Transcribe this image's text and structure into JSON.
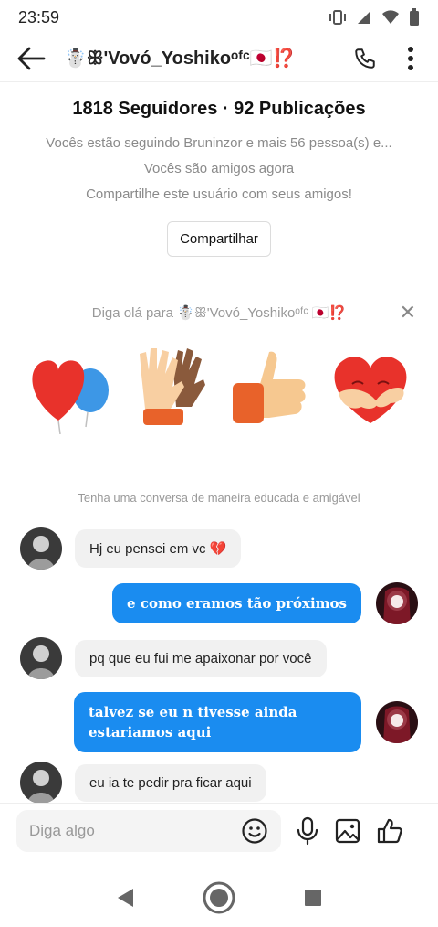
{
  "status": {
    "time": "23:59"
  },
  "header": {
    "title": "☃️ꕥ'Vovó_Yoshikoᵒᶠᶜ🇯🇵⁉️"
  },
  "profile": {
    "stats": "1818 Seguidores · 92 Publicações",
    "following_line": "Vocês estão seguindo Bruninzor e mais 56 pessoa(s) e...",
    "friends_line": "Vocês são amigos agora",
    "share_line": "Compartilhe este usuário com seus amigos!",
    "share_button": "Compartilhar"
  },
  "hello": {
    "text": "Diga olá para ☃️ꕥ'Vovó_Yoshikoᵒᶠᶜ 🇯🇵⁉️"
  },
  "conversation_hint": "Tenha uma conversa de maneira educada e amigável",
  "messages": [
    {
      "from": "them",
      "text": "Hj eu pensei em vc 💔"
    },
    {
      "from": "me",
      "text": "e como eramos tão próximos"
    },
    {
      "from": "them",
      "text": "pq que eu fui me apaixonar por você"
    },
    {
      "from": "me",
      "text": "talvez se eu n tivesse ainda estariamos aqui"
    },
    {
      "from": "them",
      "text": "eu ia te pedir pra ficar aqui"
    }
  ],
  "input": {
    "placeholder": "Diga algo"
  },
  "colors": {
    "accent": "#1a8cf0",
    "incoming_bubble": "#f1f1f1"
  },
  "icons": [
    "back-arrow-icon",
    "phone-icon",
    "more-vert-icon",
    "close-icon",
    "emoji-icon",
    "mic-icon",
    "image-icon",
    "thumbs-up-icon",
    "nav-back-icon",
    "nav-home-icon",
    "nav-recents-icon"
  ]
}
